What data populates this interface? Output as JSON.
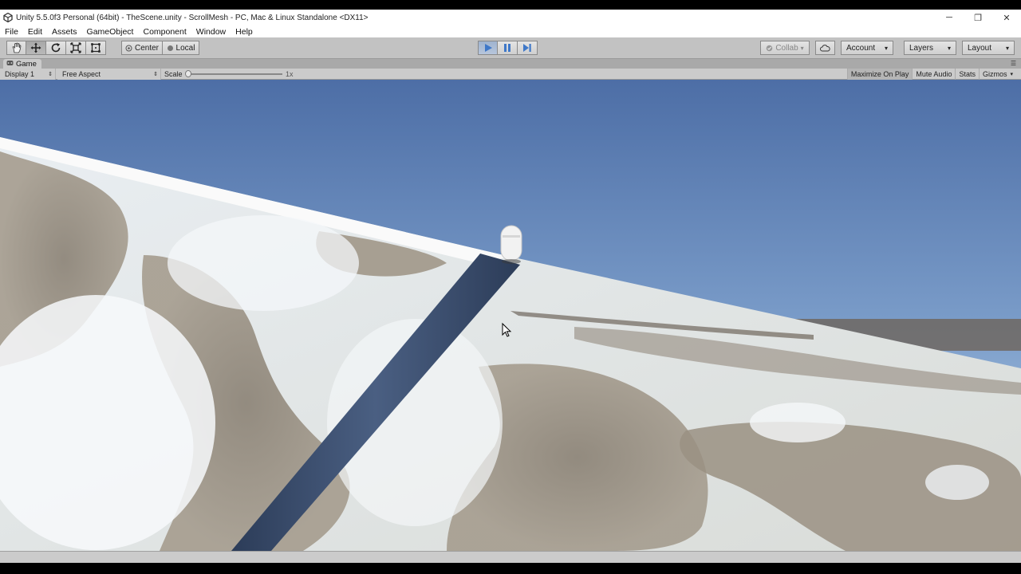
{
  "window": {
    "title": "Unity 5.5.0f3 Personal (64bit) - TheScene.unity - ScrollMesh - PC, Mac & Linux Standalone <DX11>",
    "minimize": "─",
    "restore": "❐",
    "close": "✕"
  },
  "menu": [
    "File",
    "Edit",
    "Assets",
    "GameObject",
    "Component",
    "Window",
    "Help"
  ],
  "toolbar": {
    "transform_tools": [
      "hand-tool",
      "move-tool",
      "rotate-tool",
      "scale-tool",
      "rect-tool"
    ],
    "pivot_mode": "Center",
    "pivot_space": "Local",
    "collab": "Collab",
    "account": "Account",
    "layers": "Layers",
    "layout": "Layout",
    "dropdown_arrow": "▾"
  },
  "game_view": {
    "tab_label": "Game",
    "display": "Display 1",
    "aspect": "Free Aspect",
    "scale_label": "Scale",
    "scale_value": "1x",
    "scale_fraction": 0.0,
    "toggles": {
      "maximize": "Maximize On Play",
      "mute": "Mute Audio",
      "stats": "Stats",
      "gizmos": "Gizmos"
    }
  },
  "colors": {
    "play_active": "#3f78c8",
    "sky_top": "#4f6fa6",
    "sky_horizon": "#a8c4e0"
  }
}
